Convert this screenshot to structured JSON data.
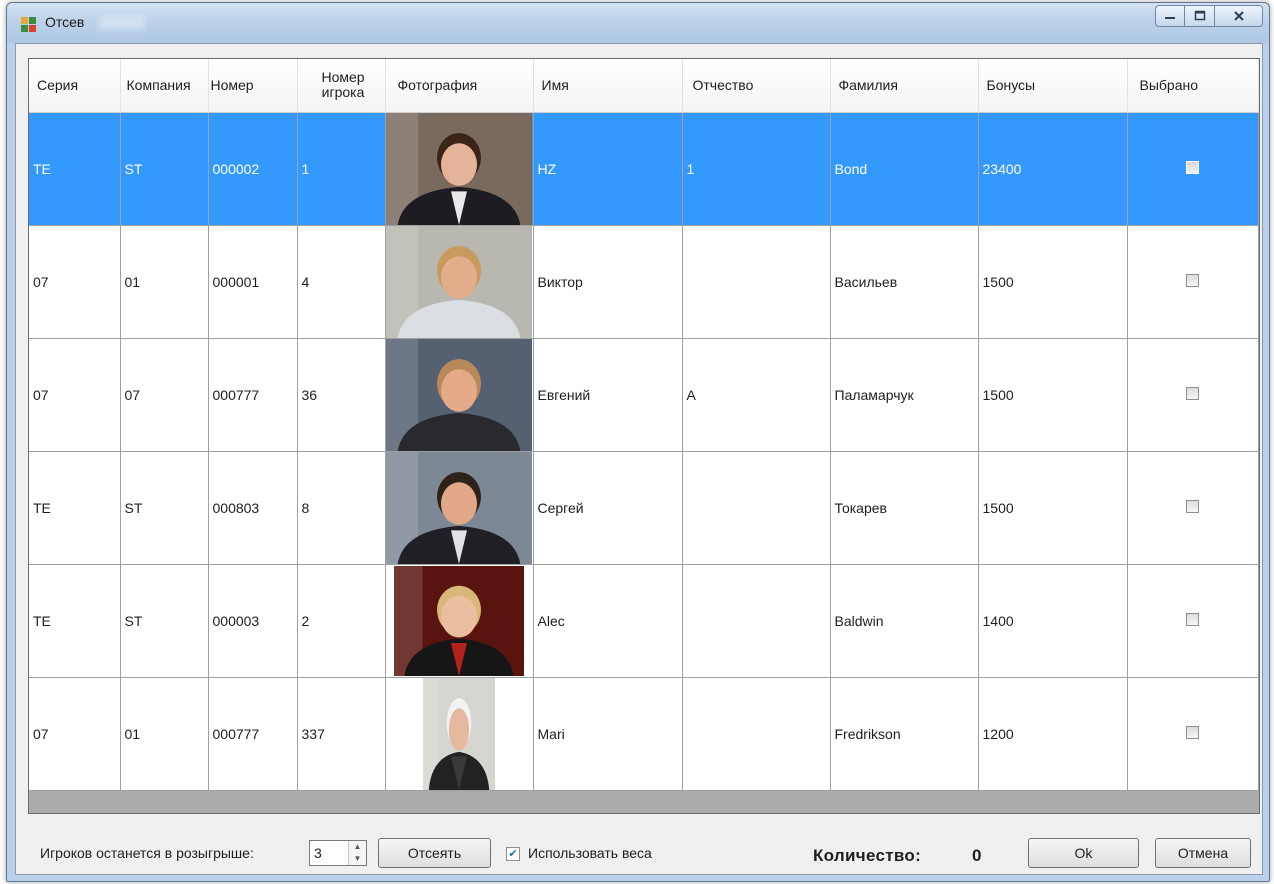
{
  "window": {
    "title": "Отсев",
    "minimize_icon": "minimize-icon",
    "maximize_icon": "maximize-icon",
    "close_icon": "close-icon"
  },
  "grid": {
    "columns": [
      "Серия",
      "Компания",
      "Номер",
      "Номер игрока",
      "Фотография",
      "Имя",
      "Отчество",
      "Фамилия",
      "Бонусы",
      "Выбрано"
    ],
    "column_lines": {
      "player_number": [
        "Номер",
        "игрока"
      ]
    },
    "rows": [
      {
        "series": "TE",
        "company": "ST",
        "number": "000002",
        "player_number": "1",
        "photo": "portrait-long-hair-dark-suit",
        "first_name": "HZ",
        "patronymic": "1",
        "last_name": "Bond",
        "bonus": "23400",
        "selected": false,
        "highlighted": true
      },
      {
        "series": "07",
        "company": "01",
        "number": "000001",
        "player_number": "4",
        "photo": "portrait-office-man",
        "first_name": "Виктор",
        "patronymic": "",
        "last_name": "Васильев",
        "bonus": "1500",
        "selected": false,
        "highlighted": false
      },
      {
        "series": "07",
        "company": "07",
        "number": "000777",
        "player_number": "36",
        "photo": "portrait-smiling-man-exhibition",
        "first_name": "Евгений",
        "patronymic": "А",
        "last_name": "Паламарчук",
        "bonus": "1500",
        "selected": false,
        "highlighted": false
      },
      {
        "series": "TE",
        "company": "ST",
        "number": "000803",
        "player_number": "8",
        "photo": "portrait-man-exhibition",
        "first_name": "Сергей",
        "patronymic": "",
        "last_name": "Токарев",
        "bonus": "1500",
        "selected": false,
        "highlighted": false
      },
      {
        "series": "TE",
        "company": "ST",
        "number": "000003",
        "player_number": "2",
        "photo": "portrait-blond-man-red-shirt",
        "first_name": "Alec",
        "patronymic": "",
        "last_name": "Baldwin",
        "bonus": "1400",
        "selected": false,
        "highlighted": false
      },
      {
        "series": "07",
        "company": "01",
        "number": "000777",
        "player_number": "337",
        "photo": "portrait-white-hair-woman",
        "first_name": "Mari",
        "patronymic": "",
        "last_name": "Fredrikson",
        "bonus": "1200",
        "selected": false,
        "highlighted": false
      }
    ]
  },
  "footer": {
    "remaining_label": "Игроков останется в розыгрыше:",
    "remaining_value": "3",
    "filter_button": "Отсеять",
    "use_weights_label": "Использовать веса",
    "use_weights_checked": true,
    "count_label": "Количество:",
    "count_value": "0",
    "ok_button": "Ok",
    "cancel_button": "Отмена"
  },
  "colors": {
    "selection": "#3399ff",
    "window_frame": "#b9d1ea",
    "grid_empty": "#ababab"
  }
}
